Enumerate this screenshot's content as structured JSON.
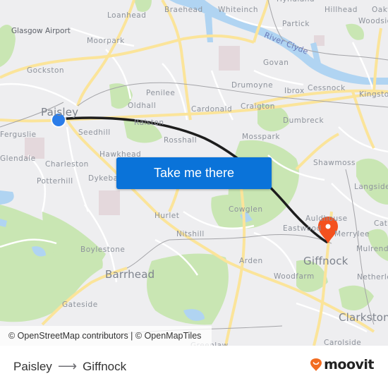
{
  "map": {
    "places": [
      {
        "name": "Glasgow Airport",
        "style": "dark"
      },
      {
        "name": "Loanhead"
      },
      {
        "name": "Braehead"
      },
      {
        "name": "Whiteinch"
      },
      {
        "name": "Hyndland"
      },
      {
        "name": "Hillhead"
      },
      {
        "name": "Oakfield"
      },
      {
        "name": "Woodside"
      },
      {
        "name": "Partick"
      },
      {
        "name": "Moorpark"
      },
      {
        "name": "River Clyde",
        "style": "river"
      },
      {
        "name": "Gockston"
      },
      {
        "name": "Govan"
      },
      {
        "name": "Drumoyne"
      },
      {
        "name": "Ibrox"
      },
      {
        "name": "Cessnock"
      },
      {
        "name": "Kingston"
      },
      {
        "name": "Penilee"
      },
      {
        "name": "Oldhall"
      },
      {
        "name": "Paisley",
        "style": "big"
      },
      {
        "name": "Cardonald"
      },
      {
        "name": "Craigton"
      },
      {
        "name": "Ralston"
      },
      {
        "name": "Dumbreck"
      },
      {
        "name": "Ferguslie"
      },
      {
        "name": "Seedhill"
      },
      {
        "name": "Rosshall"
      },
      {
        "name": "Mosspark"
      },
      {
        "name": "Hawkhead"
      },
      {
        "name": "Glendale"
      },
      {
        "name": "Charleston"
      },
      {
        "name": "Shawmoss"
      },
      {
        "name": "Potterhill"
      },
      {
        "name": "Dykebar"
      },
      {
        "name": "Langside"
      },
      {
        "name": "Cowglen"
      },
      {
        "name": "Hurlet"
      },
      {
        "name": "Auldhouse"
      },
      {
        "name": "Cathcart"
      },
      {
        "name": "Nitshill"
      },
      {
        "name": "Eastwood"
      },
      {
        "name": "Merrylee"
      },
      {
        "name": "Mulrend"
      },
      {
        "name": "Boylestone"
      },
      {
        "name": "Arden"
      },
      {
        "name": "Giffnock",
        "style": "big"
      },
      {
        "name": "Barrhead",
        "style": "big"
      },
      {
        "name": "Woodfarm"
      },
      {
        "name": "Netherlee"
      },
      {
        "name": "Gateside"
      },
      {
        "name": "Clarkston",
        "style": "big"
      },
      {
        "name": "Carolside"
      },
      {
        "name": "Greenlaw"
      }
    ],
    "origin_marker": {
      "label": "Paisley",
      "color": "#2b7de9"
    },
    "destination_marker": {
      "label": "Giffnock",
      "color": "#f4511e"
    },
    "route_color": "#1d1d1d",
    "attribution": "© OpenStreetMap contributors | © OpenMapTiles"
  },
  "cta": {
    "label": "Take me there",
    "color": "#0a73d9"
  },
  "footer": {
    "origin": "Paisley",
    "arrow": "⟶",
    "destination": "Giffnock",
    "brand": "moovit",
    "brand_color": "#f26d21"
  }
}
